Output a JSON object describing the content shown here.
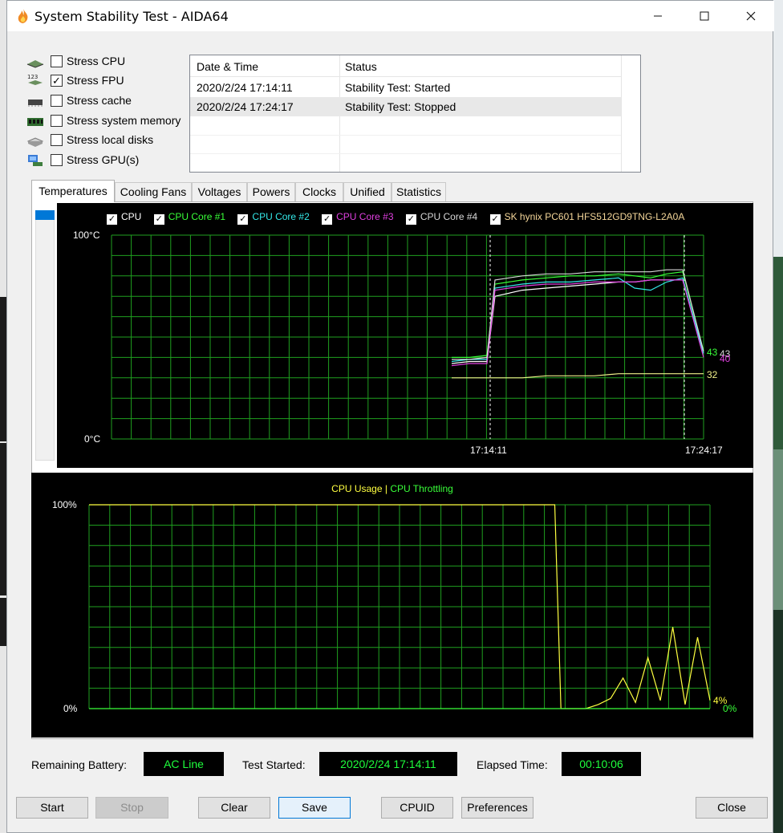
{
  "window": {
    "title": "System Stability Test - AIDA64"
  },
  "stress_options": [
    {
      "label": "Stress CPU",
      "checked": false,
      "icon": "cpu-chip-icon"
    },
    {
      "label": "Stress FPU",
      "checked": true,
      "icon": "fpu-123-icon"
    },
    {
      "label": "Stress cache",
      "checked": false,
      "icon": "cache-chip-icon"
    },
    {
      "label": "Stress system memory",
      "checked": false,
      "icon": "memory-module-icon"
    },
    {
      "label": "Stress local disks",
      "checked": false,
      "icon": "disk-drive-icon"
    },
    {
      "label": "Stress GPU(s)",
      "checked": false,
      "icon": "gpu-icon"
    }
  ],
  "log": {
    "col_date": "Date & Time",
    "col_status": "Status",
    "rows": [
      {
        "date": "2020/2/24 17:14:11",
        "status": "Stability Test: Started"
      },
      {
        "date": "2020/2/24 17:24:17",
        "status": "Stability Test: Stopped"
      }
    ]
  },
  "tabs": [
    "Temperatures",
    "Cooling Fans",
    "Voltages",
    "Powers",
    "Clocks",
    "Unified",
    "Statistics"
  ],
  "active_tab": "Temperatures",
  "colors": {
    "grid": "#1fa01f",
    "cpu": "#ffffff",
    "core1": "#39ff39",
    "core2": "#34e8e8",
    "core3": "#e040e0",
    "core4": "#d8d8d8",
    "ssd": "#f0f08a",
    "usage": "#ffff40",
    "throttling": "#39ff39",
    "status_text": "#1eff3c"
  },
  "chart_data": [
    {
      "type": "line",
      "legend": [
        "CPU",
        "CPU Core #1",
        "CPU Core #2",
        "CPU Core #3",
        "CPU Core #4",
        "SK hynix PC601 HFS512GD9TNG-L2A0A"
      ],
      "y_top_label": "100°C",
      "y_bottom_label": "0°C",
      "ylim": [
        0,
        100
      ],
      "markers": [
        "17:14:11",
        "17:24:17"
      ],
      "end_values": {
        "core1": "43",
        "core4": "43",
        "core3": "40",
        "ssd": "32"
      },
      "series": [
        {
          "name": "CPU",
          "x": [
            0,
            1,
            2,
            3,
            4,
            5,
            6,
            7,
            8,
            9,
            10,
            11,
            12,
            13
          ],
          "values": [
            37,
            38,
            38,
            70,
            73,
            74,
            75,
            76,
            77,
            77,
            78,
            78,
            78,
            42
          ]
        },
        {
          "name": "CPU Core #1",
          "x": [
            0,
            1,
            2,
            3,
            4,
            5,
            6,
            7,
            8,
            9,
            10,
            11,
            12,
            13
          ],
          "values": [
            40,
            40,
            41,
            76,
            78,
            79,
            80,
            80,
            81,
            80,
            79,
            81,
            82,
            43
          ]
        },
        {
          "name": "CPU Core #2",
          "x": [
            0,
            1,
            2,
            3,
            4,
            5,
            6,
            7,
            8,
            9,
            10,
            11,
            12,
            13
          ],
          "values": [
            38,
            39,
            39,
            74,
            76,
            77,
            77,
            78,
            79,
            74,
            73,
            77,
            79,
            42
          ]
        },
        {
          "name": "CPU Core #3",
          "x": [
            0,
            1,
            2,
            3,
            4,
            5,
            6,
            7,
            8,
            9,
            10,
            11,
            12,
            13
          ],
          "values": [
            36,
            37,
            37,
            73,
            75,
            76,
            76,
            77,
            77,
            77,
            78,
            78,
            78,
            40
          ]
        },
        {
          "name": "CPU Core #4",
          "x": [
            0,
            1,
            2,
            3,
            4,
            5,
            6,
            7,
            8,
            9,
            10,
            11,
            12,
            13
          ],
          "values": [
            39,
            39,
            40,
            78,
            80,
            81,
            81,
            82,
            82,
            82,
            82,
            83,
            83,
            43
          ]
        },
        {
          "name": "SK hynix PC601 HFS512GD9TNG-L2A0A",
          "x": [
            0,
            1,
            2,
            3,
            4,
            5,
            6,
            7,
            8,
            9,
            10,
            11,
            12,
            13
          ],
          "values": [
            30,
            30,
            30,
            30,
            30,
            31,
            31,
            31,
            32,
            32,
            32,
            32,
            32,
            32
          ]
        }
      ]
    },
    {
      "type": "line",
      "legend": [
        "CPU Usage",
        "CPU Throttling"
      ],
      "y_top_label": "100%",
      "y_bottom_label": "0%",
      "ylim": [
        0,
        100
      ],
      "end_values": {
        "usage": "4%",
        "throttling": "0%"
      },
      "series": [
        {
          "name": "CPU Usage",
          "x": [
            0,
            10,
            20,
            30,
            40,
            50,
            60,
            70,
            75,
            76,
            80,
            82,
            84,
            86,
            88,
            90,
            92,
            94,
            96,
            98,
            100
          ],
          "values": [
            100,
            100,
            100,
            100,
            100,
            100,
            100,
            100,
            100,
            0,
            0,
            2,
            5,
            15,
            3,
            25,
            4,
            40,
            2,
            35,
            4
          ]
        },
        {
          "name": "CPU Throttling",
          "x": [
            0,
            100
          ],
          "values": [
            0,
            0
          ]
        }
      ]
    }
  ],
  "status_bar": {
    "battery_label": "Remaining Battery:",
    "battery_value": "AC Line",
    "started_label": "Test Started:",
    "started_value": "2020/2/24 17:14:11",
    "elapsed_label": "Elapsed Time:",
    "elapsed_value": "00:10:06"
  },
  "buttons": {
    "start": "Start",
    "stop": "Stop",
    "clear": "Clear",
    "save": "Save",
    "cpuid": "CPUID",
    "preferences": "Preferences",
    "close": "Close"
  }
}
